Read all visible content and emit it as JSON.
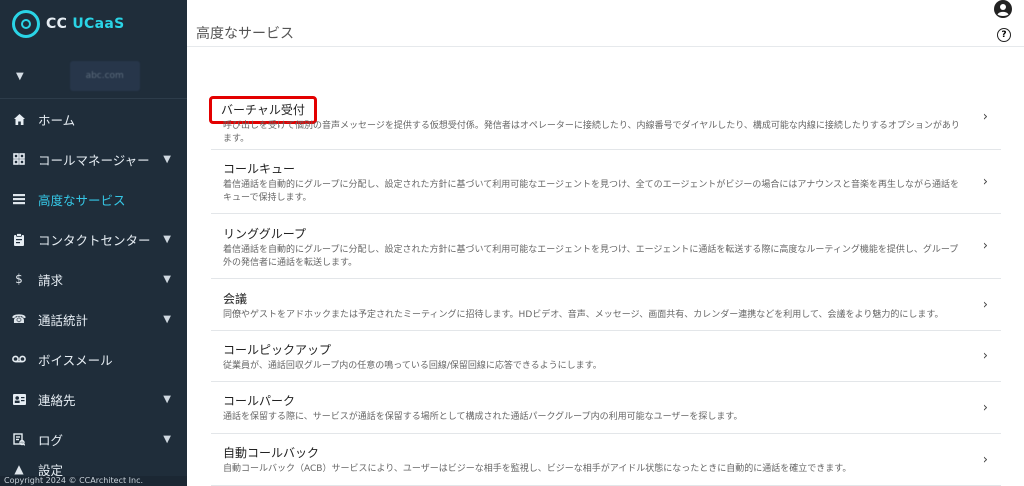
{
  "brand": {
    "name_prefix": "CC",
    "name_suffix": "UCaaS"
  },
  "user": {
    "name": "abc.com"
  },
  "sidebar": {
    "items": [
      {
        "label": "ホーム",
        "icon": "home-icon"
      },
      {
        "label": "コールマネージャー",
        "icon": "grid-icon"
      },
      {
        "label": "高度なサービス",
        "icon": "list-icon",
        "active": true
      },
      {
        "label": "コンタクトセンター",
        "icon": "clipboard-icon"
      },
      {
        "label": "請求",
        "icon": "dollar-icon"
      },
      {
        "label": "通話統計",
        "icon": "phone-icon"
      },
      {
        "label": "ボイスメール",
        "icon": "voicemail-icon"
      },
      {
        "label": "連絡先",
        "icon": "contact-card-icon"
      },
      {
        "label": "ログ",
        "icon": "log-icon"
      },
      {
        "label": "設定"
      }
    ],
    "copyright": "Copyright 2024 © CCArchitect Inc."
  },
  "header": {
    "title": "高度なサービス"
  },
  "services": [
    {
      "title": "バーチャル受付",
      "desc": "呼び出しを受けて個別の音声メッセージを提供する仮想受付係。発信者はオペレーターに接続したり、内線番号でダイヤルしたり、構成可能な内線に接続したりするオプションがあります。"
    },
    {
      "title": "コールキュー",
      "desc": "着信通話を自動的にグループに分配し、設定された方針に基づいて利用可能なエージェントを見つけ、全てのエージェントがビジーの場合にはアナウンスと音楽を再生しながら通話をキューで保持します。"
    },
    {
      "title": "リンググループ",
      "desc": "着信通話を自動的にグループに分配し、設定された方針に基づいて利用可能なエージェントを見つけ、エージェントに通話を転送する際に高度なルーティング機能を提供し、グループ外の発信者に通話を転送します。"
    },
    {
      "title": "会議",
      "desc": "同僚やゲストをアドホックまたは予定されたミーティングに招待します。HDビデオ、音声、メッセージ、画面共有、カレンダー連携などを利用して、会議をより魅力的にします。"
    },
    {
      "title": "コールピックアップ",
      "desc": "従業員が、通話回収グループ内の任意の鳴っている回線/保留回線に応答できるようにします。"
    },
    {
      "title": "コールパーク",
      "desc": "通話を保留する際に、サービスが通話を保留する場所として構成された通話パークグループ内の利用可能なユーザーを探します。"
    },
    {
      "title": "自動コールバック",
      "desc": "自動コールバック（ACB）サービスにより、ユーザーはビジーな相手を監視し、ビジーな相手がアイドル状態になったときに自動的に通話を確立できます。"
    }
  ],
  "colors": {
    "sidebar_bg": "#1f2d3a",
    "accent": "#35c7e6",
    "highlight": "#e30000"
  }
}
